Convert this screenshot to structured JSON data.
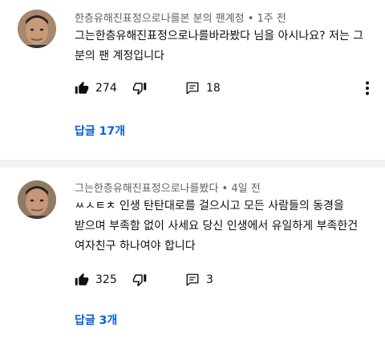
{
  "comments": [
    {
      "meta": "한층유해진표정으로나를본 분의 팬계정 • 1주 전",
      "text": "그는한층유해진표정으로나를바라봤다 님을 아시나요? 저는 그 분의 팬 계정입니다",
      "likes": "274",
      "reply_count": "18",
      "replies_link": "답글 17개"
    },
    {
      "meta": "그는한층유해진표정으로나를봤다 • 4일 전",
      "text": "ㅆㅅㅌㅊ 인생 탄탄대로를 걸으시고 모든 사람들의 동경을 받으며 부족함 없이 사세요 당신 인생에서 유일하게 부족한건 여자친구 하나여야 합니다",
      "likes": "325",
      "reply_count": "3",
      "replies_link": "답글 3개"
    }
  ],
  "icons": {
    "like": "thumbs-up-icon",
    "dislike": "thumbs-down-icon",
    "reply": "reply-comment-icon",
    "more": "more-vertical-icon"
  },
  "colors": {
    "link": "#065fd4",
    "meta": "#606060",
    "separator": "#f2f2f2"
  }
}
